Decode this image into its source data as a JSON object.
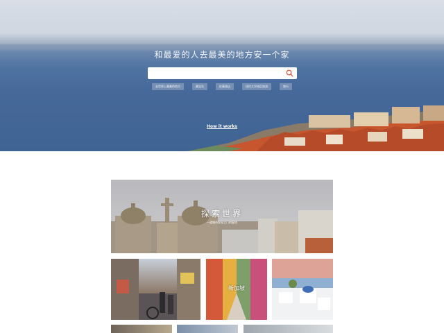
{
  "hero": {
    "title": "和最爱的人去最美的地方安一个家",
    "search": {
      "placeholder": "",
      "value": ""
    },
    "tags": [
      "去世界上最美的地方",
      "藏宝岛",
      "佐藤酒店",
      "纽约大学校区旅游",
      "旅行"
    ],
    "how_it_works": "How it works"
  },
  "explore": {
    "title": "探索世界",
    "subtitle": "一道城市发现之门的窗帘",
    "tiles": [
      {
        "label": ""
      },
      {
        "label": "新加坡"
      },
      {
        "label": ""
      }
    ]
  },
  "colors": {
    "sea": "#46699a",
    "search_icon": "#e0533a",
    "roof": "#c7552e"
  },
  "icons": [
    "search-icon"
  ]
}
